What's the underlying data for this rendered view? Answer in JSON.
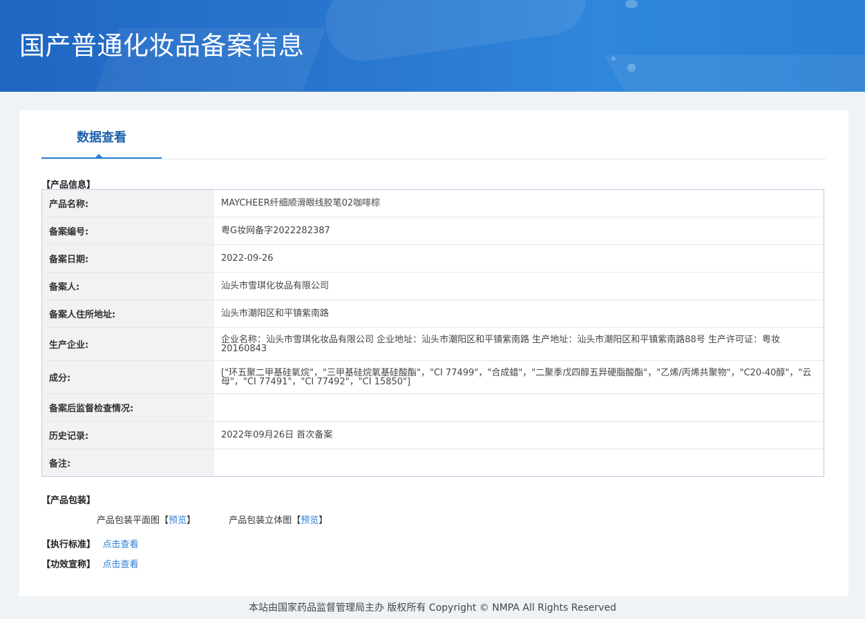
{
  "banner": {
    "title": "国产普通化妆品备案信息"
  },
  "tabs": [
    {
      "label": "数据查看"
    }
  ],
  "product_info": {
    "section_label": "【产品信息】",
    "rows": [
      {
        "key": "产品名称:",
        "value": "MAYCHEER纤细顺滑眼线胶笔02咖啡棕"
      },
      {
        "key": "备案编号:",
        "value": "粤G妆网备字2022282387"
      },
      {
        "key": "备案日期:",
        "value": "2022-09-26"
      },
      {
        "key": "备案人:",
        "value": "汕头市雪琪化妆品有限公司"
      },
      {
        "key": "备案人住所地址:",
        "value": "汕头市潮阳区和平镇紫南路"
      },
      {
        "key": "生产企业:",
        "value": "企业名称：汕头市雪琪化妆品有限公司 企业地址：汕头市潮阳区和平镇紫南路 生产地址：汕头市潮阳区和平镇紫南路88号 生产许可证：粤妆20160843"
      },
      {
        "key": "成分:",
        "value": "[\"环五聚二甲基硅氧烷\"，\"三甲基硅烷氧基硅酸酯\"，\"CI 77499\"，\"合成蜡\"，\"二聚季戊四醇五异硬脂酸酯\"，\"乙烯/丙烯共聚物\"，\"C20-40醇\"，\"云母\"，\"CI 77491\"，\"CI 77492\"，\"CI 15850\"]"
      },
      {
        "key": "备案后监督检查情况:",
        "value": ""
      },
      {
        "key": "历史记录:",
        "value": "2022年09月26日 首次备案"
      },
      {
        "key": "备注:",
        "value": ""
      }
    ]
  },
  "packaging": {
    "section_label": "【产品包装】",
    "flat_label": "产品包装平面图",
    "flat_bracket_open": "【",
    "flat_link": "预览",
    "flat_bracket_close": "】",
    "solid_label": "产品包装立体图 ",
    "solid_bracket_open": "【",
    "solid_link": "预览",
    "solid_bracket_close": "】"
  },
  "standard": {
    "label": "【执行标准】",
    "link": "点击查看"
  },
  "efficacy": {
    "label": "【功效宣称】",
    "link": "点击查看"
  },
  "footer": {
    "text": "本站由国家药品监督管理局主办 版权所有 Copyright © NMPA All Rights Reserved"
  }
}
